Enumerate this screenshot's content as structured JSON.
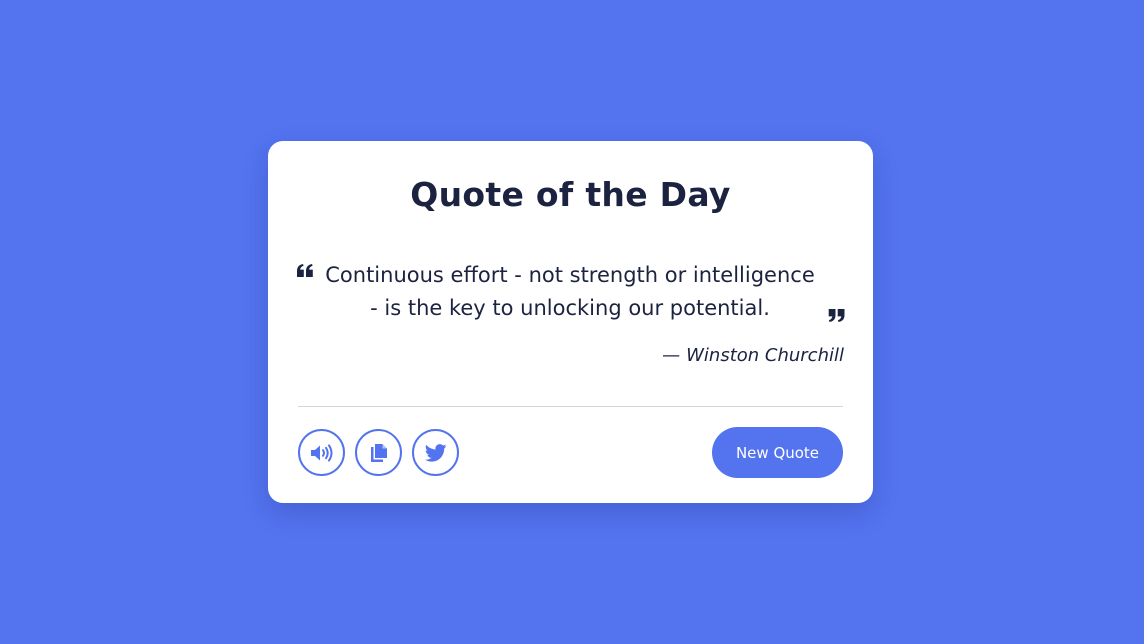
{
  "card": {
    "title": "Quote of the Day",
    "quote": "Continuous effort - not strength or intelligence - is the key to unlocking our potential.",
    "author_dash": "—",
    "author": "Winston Churchill"
  },
  "actions": {
    "icons": [
      "speaker-icon",
      "copy-icon",
      "twitter-icon"
    ],
    "new_quote_label": "New Quote"
  },
  "colors": {
    "background": "#5373ef",
    "accent": "#5373ef",
    "text": "#1c2340",
    "card": "#ffffff",
    "divider": "#d3d5dc"
  }
}
